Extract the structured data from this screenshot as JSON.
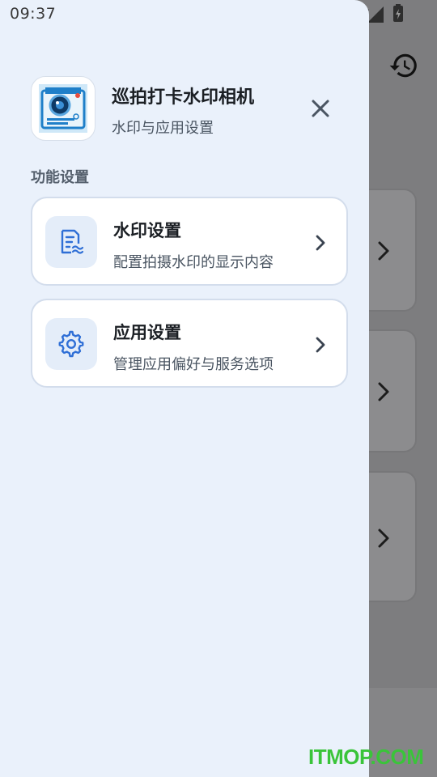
{
  "status_bar": {
    "time": "09:37"
  },
  "drawer": {
    "app_name": "巡拍打卡水印相机",
    "app_subtitle": "水印与应用设置",
    "section_label": "功能设置",
    "items": [
      {
        "title": "水印设置",
        "subtitle": "配置拍摄水印的显示内容",
        "icon": "watermark-doc-icon"
      },
      {
        "title": "应用设置",
        "subtitle": "管理应用偏好与服务选项",
        "icon": "gear-icon"
      }
    ]
  },
  "watermark_text": "ITMOP.COM",
  "colors": {
    "accent": "#2f6fd6",
    "drawer_bg": "#eaf1fb",
    "card_border": "#d3ddec",
    "watermark": "#3ac43a"
  }
}
